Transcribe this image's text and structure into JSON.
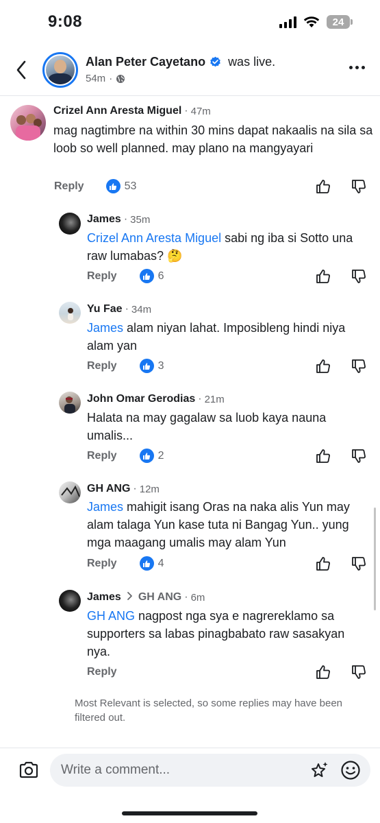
{
  "status_bar": {
    "time": "9:08",
    "battery": "24"
  },
  "header": {
    "name": "Alan Peter Cayetano",
    "action": "was live.",
    "time": "54m",
    "sub_dot": "·"
  },
  "comments": [
    {
      "name": "Crizel Ann Aresta Miguel",
      "time": "47m",
      "text": "mag nagtimbre na within 30 mins dapat nakaalis na sila sa loob so well planned. may plano na mangyayari",
      "reply": "Reply",
      "likes": "53"
    },
    {
      "name": "James",
      "time": "35m",
      "mention": "Crizel Ann Aresta Miguel",
      "text": " sabi ng iba si Sotto una raw lumabas? 🤔",
      "reply": "Reply",
      "likes": "6"
    },
    {
      "name": "Yu Fae",
      "time": "34m",
      "mention": "James",
      "text": " alam niyan lahat. Imposibleng hindi niya alam yan",
      "reply": "Reply",
      "likes": "3"
    },
    {
      "name": "John Omar Gerodias",
      "time": "21m",
      "text": "Halata na may gagalaw sa luob kaya nauna umalis...",
      "reply": "Reply",
      "likes": "2"
    },
    {
      "name": "GH ANG",
      "time": "12m",
      "mention": "James",
      "text": " mahigit isang Oras na naka alis Yun may alam talaga Yun kase tuta ni Bangag Yun.. yung mga maagang umalis may alam Yun",
      "reply": "Reply",
      "likes": "4"
    },
    {
      "name": "James",
      "reply_to": "GH ANG",
      "time": "6m",
      "mention": "GH ANG",
      "text": " nagpost nga sya e nagrereklamo sa supporters sa labas pinagbabato raw sasakyan nya.",
      "reply": "Reply"
    }
  ],
  "filter_note": "Most Relevant is selected, so some replies may have been filtered out.",
  "composer": {
    "placeholder": "Write a comment..."
  },
  "colors": {
    "accent": "#1877f2",
    "muted": "#65676b",
    "text": "#1c1e21"
  }
}
